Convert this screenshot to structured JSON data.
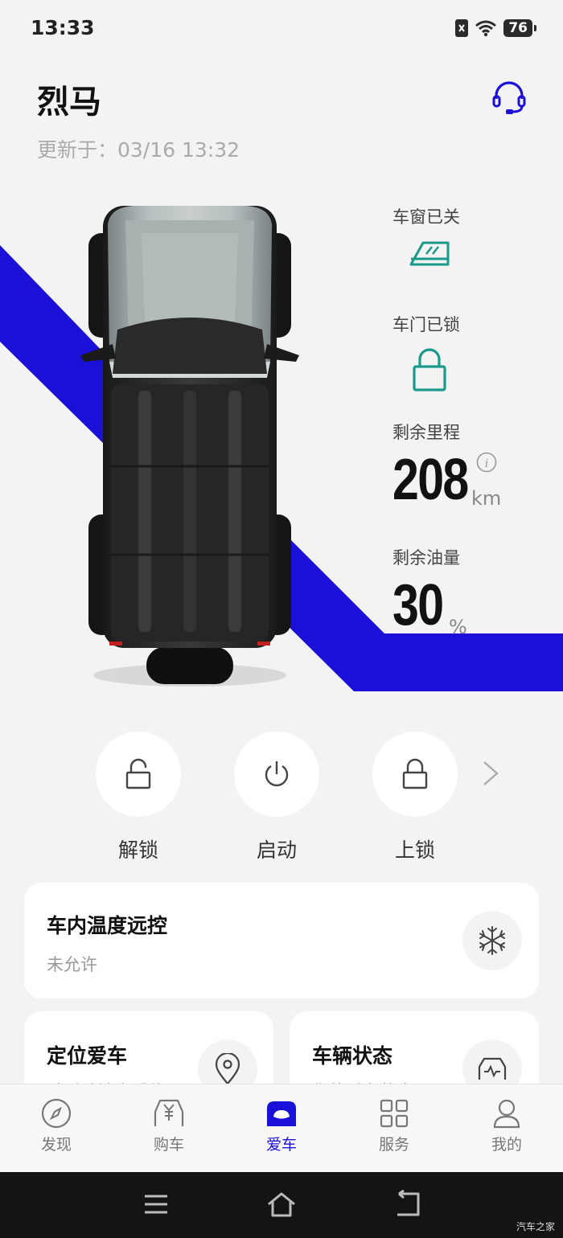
{
  "status_bar": {
    "time": "13:33",
    "battery": "76"
  },
  "header": {
    "title": "烈马",
    "updated": "更新于：03/16 13:32"
  },
  "status": {
    "window": {
      "label": "车窗已关"
    },
    "door": {
      "label": "车门已锁"
    },
    "range": {
      "label": "剩余里程",
      "value": "208",
      "unit": "km"
    },
    "fuel": {
      "label": "剩余油量",
      "value": "30",
      "unit": "%"
    }
  },
  "actions": [
    {
      "label": "解锁",
      "icon": "unlock-icon"
    },
    {
      "label": "启动",
      "icon": "power-icon"
    },
    {
      "label": "上锁",
      "icon": "lock-icon"
    }
  ],
  "cards": {
    "climate": {
      "title": "车内温度远控",
      "subtitle": "未允许",
      "icon": "snowflake-icon"
    },
    "locate": {
      "title": "定位爱车",
      "subtitle": "随时随地查看位置",
      "icon": "location-pin-icon"
    },
    "vehicle": {
      "title": "车辆状态",
      "subtitle": "您的爱车状态",
      "icon": "car-status-icon"
    }
  },
  "tabs": [
    {
      "label": "发现",
      "icon": "compass-icon"
    },
    {
      "label": "购车",
      "icon": "car-purchase-icon"
    },
    {
      "label": "爱车",
      "icon": "car-icon",
      "active": true
    },
    {
      "label": "服务",
      "icon": "grid-icon"
    },
    {
      "label": "我的",
      "icon": "profile-icon"
    }
  ],
  "watermark": "汽车之家",
  "colors": {
    "accent": "#1a10d8",
    "teal": "#1a9a8a",
    "background": "#f3f3f3"
  }
}
